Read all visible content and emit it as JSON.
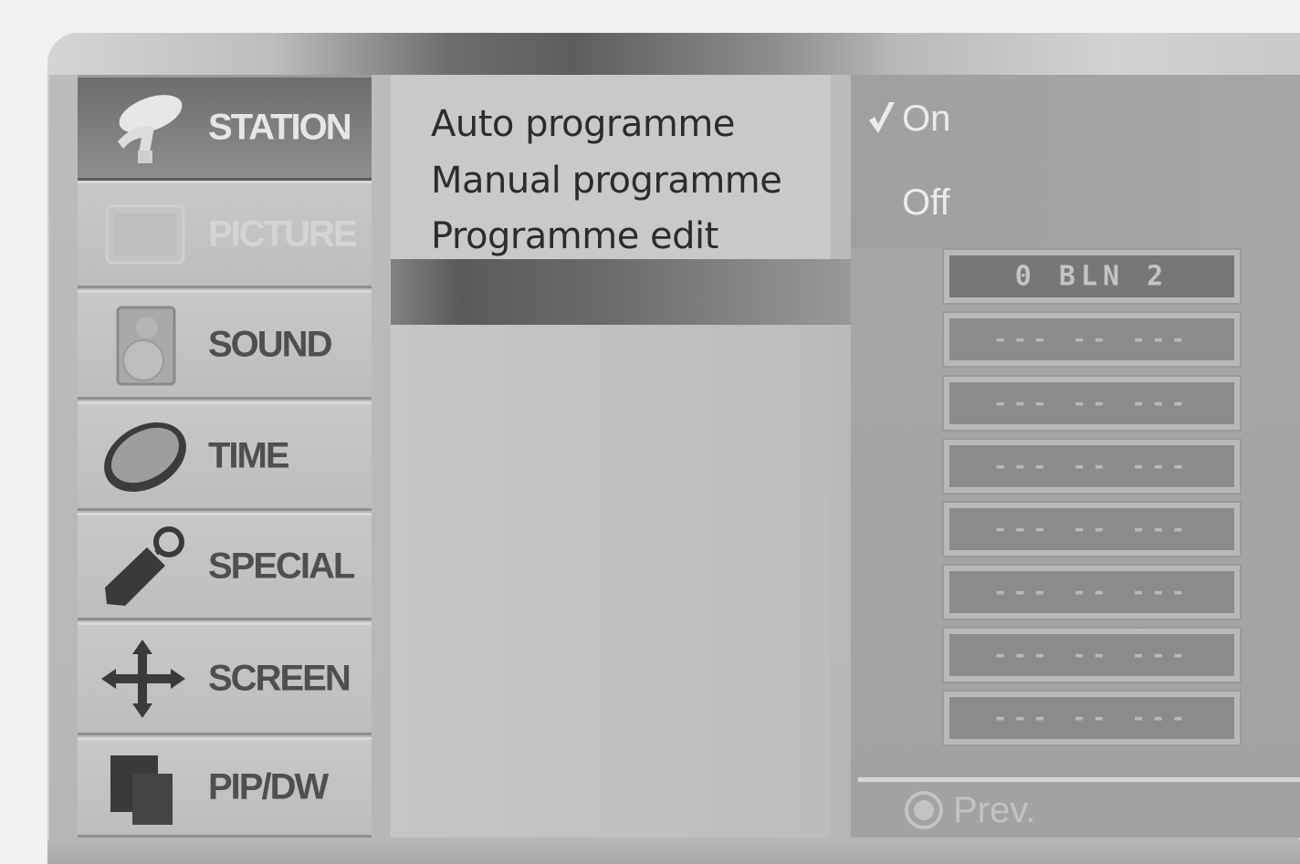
{
  "categories": [
    {
      "label": "STATION",
      "icon": "satellite-dish-icon"
    },
    {
      "label": "PICTURE",
      "icon": "tv-icon"
    },
    {
      "label": "SOUND",
      "icon": "speaker-icon"
    },
    {
      "label": "TIME",
      "icon": "clock-icon"
    },
    {
      "label": "SPECIAL",
      "icon": "tag-icon"
    },
    {
      "label": "SCREEN",
      "icon": "move-arrows-icon"
    },
    {
      "label": "PIP/DW",
      "icon": "pip-icon"
    }
  ],
  "active_category": "STATION",
  "submenu": {
    "items": [
      "Auto programme",
      "Manual programme",
      "Programme edit"
    ]
  },
  "options": {
    "on_label": "On",
    "off_label": "Off",
    "selected": "On"
  },
  "programmes": [
    "0 BLN 2",
    "--- -- ---",
    "--- -- ---",
    "--- -- ---",
    "--- -- ---",
    "--- -- ---",
    "--- -- ---",
    "--- -- ---"
  ],
  "footer": {
    "prev_label": "Prev."
  },
  "colors": {
    "frame": "#bcbcbc",
    "active_category": "#6d6d6d",
    "right_panel": "#a7a7a7"
  }
}
